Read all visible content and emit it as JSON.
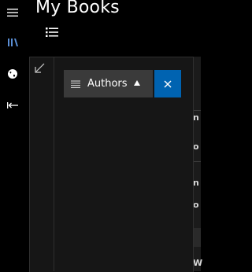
{
  "app": {
    "title": "My Books"
  },
  "nav": {
    "menu_icon": "hamburger-icon",
    "items": [
      {
        "icon": "library-icon",
        "color": "#5b8fd6"
      },
      {
        "icon": "globe-icon",
        "color": "#ffffff"
      },
      {
        "icon": "back-arrow-icon",
        "color": "#ffffff"
      }
    ]
  },
  "toolbar": {
    "list_view_icon": "list-view-icon"
  },
  "flyout": {
    "collapse_icon": "collapse-arrow-icon"
  },
  "sort": {
    "field_label": "Authors",
    "direction_icon": "triangle-up-icon",
    "close_icon": "close-icon",
    "accent": "#0063b1"
  },
  "background_rows": [
    "n",
    "o",
    "n",
    "o",
    "W"
  ]
}
